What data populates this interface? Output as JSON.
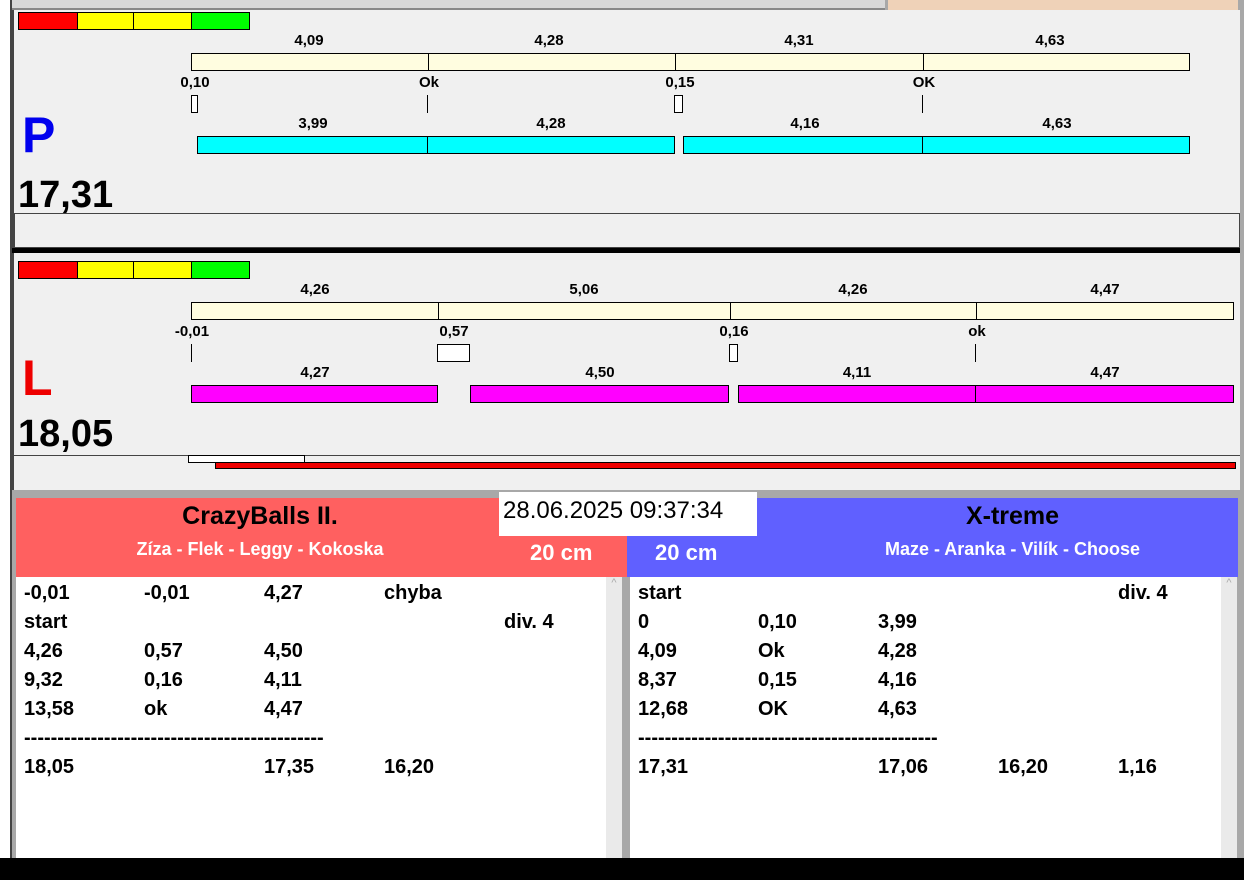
{
  "colors": {
    "red": "#ff0000",
    "yellow": "#ffff00",
    "green": "#00ff00",
    "cream": "#fffde0",
    "cyan": "#00ffff",
    "magenta": "#ff00ff",
    "team_left": "#ff6060",
    "team_right": "#6060ff"
  },
  "p": {
    "letter": "P",
    "total": "17,31",
    "times": [
      "4,09",
      "4,28",
      "4,31",
      "4,63"
    ],
    "marks": [
      "0,10",
      "Ok",
      "0,15",
      "OK"
    ],
    "run": [
      "3,99",
      "4,28",
      "4,16",
      "4,63"
    ]
  },
  "l": {
    "letter": "L",
    "total": "18,05",
    "times": [
      "4,26",
      "5,06",
      "4,26",
      "4,47"
    ],
    "marks": [
      "-0,01",
      "0,57",
      "0,16",
      "ok"
    ],
    "run": [
      "4,27",
      "4,50",
      "4,11",
      "4,47"
    ]
  },
  "datetime": "28.06.2025 09:37:34",
  "left_team": {
    "name": "CrazyBalls II.",
    "dogs": "Zíza - Flek - Leggy - Kokoska",
    "height": "20 cm",
    "rows": [
      [
        "-0,01",
        "-0,01",
        "4,27",
        "chyba",
        ""
      ],
      [
        "start",
        "",
        "",
        "",
        "div.  4"
      ],
      [
        "4,26",
        "0,57",
        "4,50",
        "",
        ""
      ],
      [
        "9,32",
        "0,16",
        "4,11",
        "",
        ""
      ],
      [
        "13,58",
        "ok",
        "4,47",
        "",
        ""
      ],
      [
        "---------------------------------------------",
        "",
        "",
        "",
        ""
      ],
      [
        "18,05",
        "",
        "17,35",
        "16,20",
        ""
      ]
    ]
  },
  "right_team": {
    "name": "X-treme",
    "dogs": "Maze - Aranka - Vilík - Choose",
    "height": "20 cm",
    "rows": [
      [
        "start",
        "",
        "",
        "",
        "div.  4"
      ],
      [
        "0",
        "0,10",
        "3,99",
        "",
        ""
      ],
      [
        "4,09",
        "Ok",
        "4,28",
        "",
        ""
      ],
      [
        "8,37",
        "0,15",
        "4,16",
        "",
        ""
      ],
      [
        "12,68",
        "OK",
        "4,63",
        "",
        ""
      ],
      [
        "---------------------------------------------",
        "",
        "",
        "",
        ""
      ],
      [
        "17,31",
        "",
        "17,06",
        "16,20",
        "1,16"
      ]
    ]
  }
}
